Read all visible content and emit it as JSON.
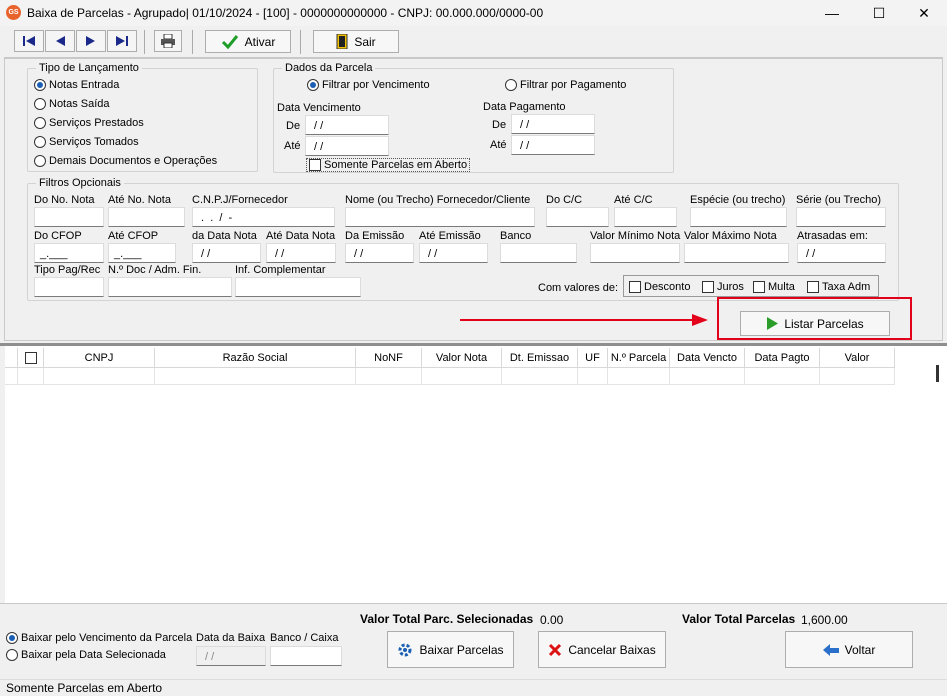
{
  "window": {
    "title": "Baixa de Parcelas - Agrupado|  01/10/2024 - [100] - 0000000000000 - CNPJ: 00.000.000/0000-00",
    "icon_text": "GS",
    "minimize": "—",
    "maximize": "☐",
    "close": "✕"
  },
  "toolbar": {
    "ativar_label": "Ativar",
    "sair_label": "Sair"
  },
  "tipo_lancamento": {
    "legend": "Tipo de Lançamento",
    "options": [
      "Notas Entrada",
      "Notas Saída",
      "Serviços Prestados",
      "Serviços Tomados",
      "Demais Documentos e Operações"
    ],
    "selected": 0
  },
  "dados_parcela": {
    "legend": "Dados da Parcela",
    "filtrar_vencimento": "Filtrar por Vencimento",
    "filtrar_pagamento": "Filtrar por Pagamento",
    "data_vencimento": "Data Vencimento",
    "data_pagamento": "Data Pagamento",
    "de": "De",
    "ate": "Até",
    "date_mask": " / /",
    "somente_aberto": "Somente Parcelas em Aberto"
  },
  "filtros": {
    "legend": "Filtros Opcionais",
    "labels": {
      "do_no_nota": "Do No. Nota",
      "ate_no_nota": "Até No. Nota",
      "cnpj_fornecedor": "C.N.P.J/Fornecedor",
      "nome_fornecedor": "Nome (ou Trecho)  Fornecedor/Cliente",
      "do_cc": "Do C/C",
      "ate_cc": "Até C/C",
      "especie": "Espécie (ou trecho)",
      "serie": "Série (ou Trecho)",
      "do_cfop": "Do CFOP",
      "ate_cfop": "Até CFOP",
      "da_data_nota": "da Data Nota",
      "ate_data_nota": "Até Data Nota",
      "da_emissao": "Da Emissão",
      "ate_emissao": "Até Emissão",
      "banco": "Banco",
      "valor_minimo": "Valor Mínimo Nota",
      "valor_maximo": "Valor Máximo Nota",
      "atrasadas": "Atrasadas em:",
      "tipo_pag": "Tipo Pag/Rec",
      "no_doc": "N.º Doc / Adm. Fin.",
      "inf_complementar": "Inf. Complementar"
    },
    "cnpj_mask": " .  .  /  -",
    "cfop_mask": "_.___",
    "date_mask": " / /",
    "com_valores": "Com valores de:",
    "desconto": "Desconto",
    "juros": "Juros",
    "multa": "Multa",
    "taxa_adm": "Taxa Adm"
  },
  "listar_label": "Listar Parcelas",
  "grid": {
    "columns": [
      "CNPJ",
      "Razão Social",
      "NoNF",
      "Valor Nota",
      "Dt. Emissao",
      "UF",
      "N.º Parcela",
      "Data Vencto",
      "Data Pagto",
      "Valor"
    ]
  },
  "bottom": {
    "baixar_vencimento": "Baixar pelo Vencimento da Parcela",
    "baixar_data": "Baixar pela Data Selecionada",
    "data_da_baixa": "Data da Baixa",
    "banco_caixa": "Banco / Caixa",
    "date_mask": " / /",
    "total_selecionadas_label": "Valor Total Parc. Selecionadas",
    "total_selecionadas_value": "0.00",
    "total_parcelas_label": "Valor Total Parcelas",
    "total_parcelas_value": "1,600.00",
    "baixar_parcelas": "Baixar Parcelas",
    "cancelar_baixas": "Cancelar Baixas",
    "voltar": "Voltar"
  },
  "status": "Somente Parcelas em Aberto"
}
